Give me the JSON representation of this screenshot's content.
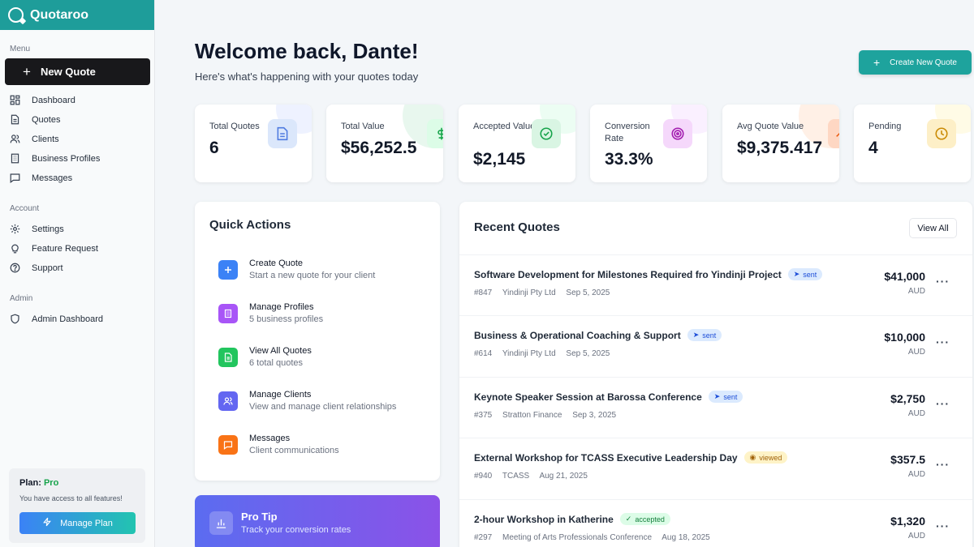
{
  "app": {
    "name": "Quotaroo"
  },
  "sidebar": {
    "menu_label": "Menu",
    "new_quote_label": "New Quote",
    "menu_items": [
      {
        "label": "Dashboard",
        "icon": "dashboard-icon"
      },
      {
        "label": "Quotes",
        "icon": "document-icon"
      },
      {
        "label": "Clients",
        "icon": "users-icon"
      },
      {
        "label": "Business Profiles",
        "icon": "building-icon"
      },
      {
        "label": "Messages",
        "icon": "message-icon"
      }
    ],
    "account_label": "Account",
    "account_items": [
      {
        "label": "Settings",
        "icon": "gear-icon"
      },
      {
        "label": "Feature Request",
        "icon": "lightbulb-icon"
      },
      {
        "label": "Support",
        "icon": "help-icon"
      }
    ],
    "admin_label": "Admin",
    "admin_items": [
      {
        "label": "Admin Dashboard",
        "icon": "shield-icon"
      }
    ],
    "plan": {
      "prefix": "Plan:",
      "name": "Pro",
      "description": "You have access to all features!",
      "button_label": "Manage Plan"
    }
  },
  "header": {
    "title": "Welcome back, Dante!",
    "subtitle": "Here's what's happening with your quotes today",
    "create_button": "Create New Quote"
  },
  "stats": [
    {
      "label": "Total Quotes",
      "value": "6",
      "icon": "document-icon",
      "color": "#4f7be0"
    },
    {
      "label": "Total Value",
      "value": "$56,252.5",
      "icon": "dollar-icon",
      "color": "#16a34a"
    },
    {
      "label": "Accepted Value",
      "value": "$2,145",
      "icon": "check-circle-icon",
      "color": "#16a34a"
    },
    {
      "label": "Conversion Rate",
      "value": "33.3%",
      "icon": "target-icon",
      "color": "#a21caf"
    },
    {
      "label": "Avg Quote Value",
      "value": "$9,375.417",
      "icon": "trend-icon",
      "color": "#ea580c"
    },
    {
      "label": "Pending",
      "value": "4",
      "icon": "clock-icon",
      "color": "#ca8a04"
    }
  ],
  "quick_actions": {
    "title": "Quick Actions",
    "items": [
      {
        "title": "Create Quote",
        "subtitle": "Start a new quote for your client",
        "icon": "plus-icon",
        "color": "#3b82f6"
      },
      {
        "title": "Manage Profiles",
        "subtitle": "5 business profiles",
        "icon": "building-icon",
        "color": "#a855f7"
      },
      {
        "title": "View All Quotes",
        "subtitle": "6 total quotes",
        "icon": "document-icon",
        "color": "#22c55e"
      },
      {
        "title": "Manage Clients",
        "subtitle": "View and manage client relationships",
        "icon": "users-icon",
        "color": "#6366f1"
      },
      {
        "title": "Messages",
        "subtitle": "Client communications",
        "icon": "message-icon",
        "color": "#f97316"
      }
    ]
  },
  "pro_tip": {
    "title": "Pro Tip",
    "subtitle": "Track your conversion rates"
  },
  "recent_quotes": {
    "title": "Recent Quotes",
    "view_all": "View All",
    "items": [
      {
        "title": "Software Development for Milestones Required fro Yindinji Project",
        "status": "sent",
        "number": "#847",
        "client": "Yindinji Pty Ltd",
        "date": "Sep 5, 2025",
        "amount": "$41,000",
        "currency": "AUD"
      },
      {
        "title": "Business & Operational Coaching & Support",
        "status": "sent",
        "number": "#614",
        "client": "Yindinji Pty Ltd",
        "date": "Sep 5, 2025",
        "amount": "$10,000",
        "currency": "AUD"
      },
      {
        "title": "Keynote Speaker Session at Barossa Conference",
        "status": "sent",
        "number": "#375",
        "client": "Stratton Finance",
        "date": "Sep 3, 2025",
        "amount": "$2,750",
        "currency": "AUD"
      },
      {
        "title": "External Workshop for TCASS Executive Leadership Day",
        "status": "viewed",
        "number": "#940",
        "client": "TCASS",
        "date": "Aug 21, 2025",
        "amount": "$357.5",
        "currency": "AUD"
      },
      {
        "title": "2-hour Workshop in Katherine",
        "status": "accepted",
        "number": "#297",
        "client": "Meeting of Arts Professionals Conference",
        "date": "Aug 18, 2025",
        "amount": "$1,320",
        "currency": "AUD"
      }
    ]
  },
  "colors": {
    "brand": "#1e9d9a",
    "accent": "#1ea39d"
  }
}
